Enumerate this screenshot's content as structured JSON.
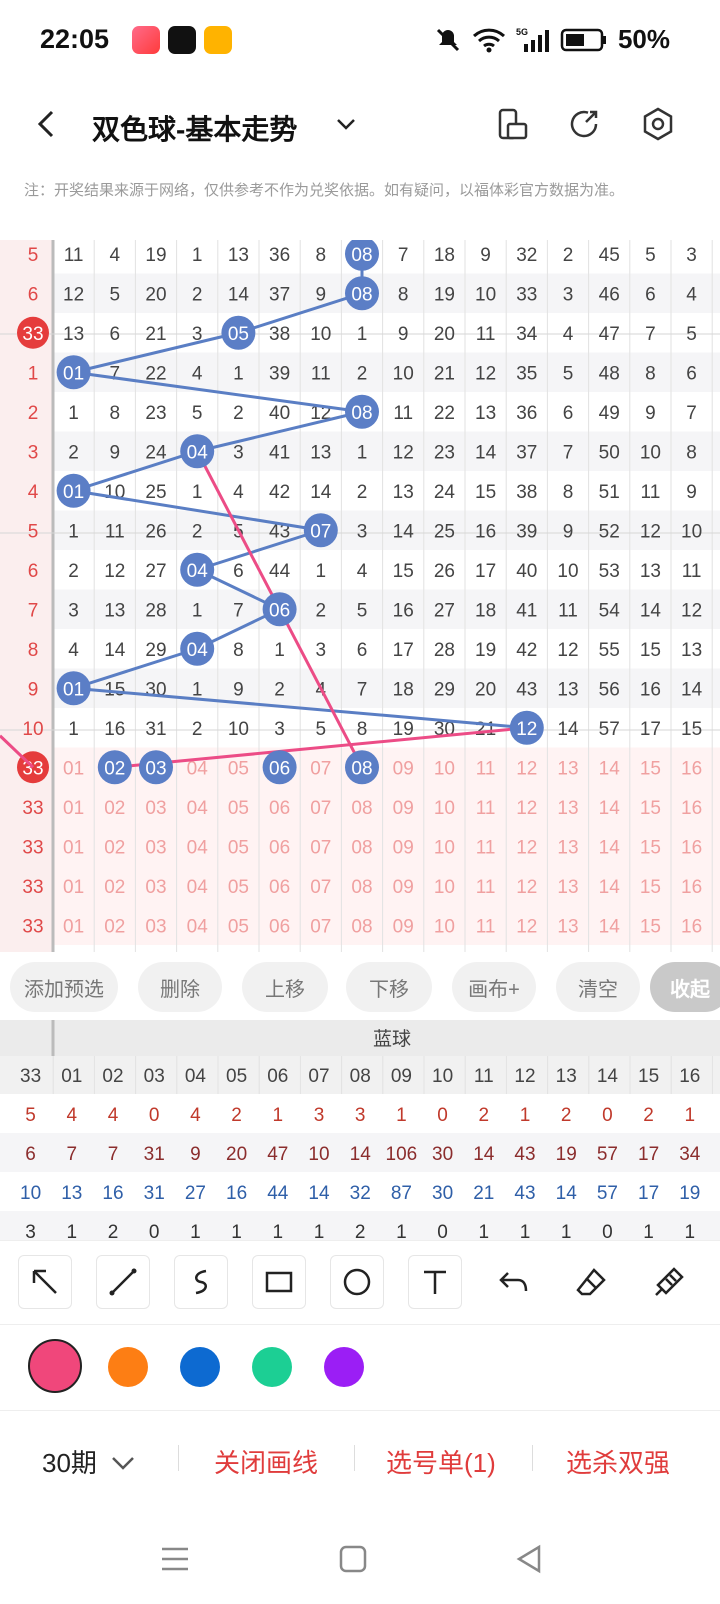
{
  "status": {
    "time": "22:05",
    "battery": "50%",
    "network": "5G"
  },
  "header": {
    "title": "双色球-基本走势"
  },
  "notice": "注：开奖结果来源于网络，仅供参考不作为兑奖依据。如有疑问，以福体彩官方数据为准。",
  "grid": {
    "left_col": [
      "5",
      "6",
      "33",
      "1",
      "2",
      "3",
      "4",
      "5",
      "6",
      "7",
      "8",
      "9",
      "10",
      "33",
      "33",
      "33",
      "33",
      "33"
    ],
    "rows": [
      [
        "11",
        "4",
        "19",
        "1",
        "13",
        "36",
        "8",
        "08",
        "7",
        "18",
        "9",
        "32",
        "2",
        "45",
        "5",
        "3"
      ],
      [
        "12",
        "5",
        "20",
        "2",
        "14",
        "37",
        "9",
        "08",
        "8",
        "19",
        "10",
        "33",
        "3",
        "46",
        "6",
        "4"
      ],
      [
        "13",
        "6",
        "21",
        "3",
        "05",
        "38",
        "10",
        "1",
        "9",
        "20",
        "11",
        "34",
        "4",
        "47",
        "7",
        "5"
      ],
      [
        "01",
        "7",
        "22",
        "4",
        "1",
        "39",
        "11",
        "2",
        "10",
        "21",
        "12",
        "35",
        "5",
        "48",
        "8",
        "6"
      ],
      [
        "1",
        "8",
        "23",
        "5",
        "2",
        "40",
        "12",
        "08",
        "11",
        "22",
        "13",
        "36",
        "6",
        "49",
        "9",
        "7"
      ],
      [
        "2",
        "9",
        "24",
        "04",
        "3",
        "41",
        "13",
        "1",
        "12",
        "23",
        "14",
        "37",
        "7",
        "50",
        "10",
        "8"
      ],
      [
        "01",
        "10",
        "25",
        "1",
        "4",
        "42",
        "14",
        "2",
        "13",
        "24",
        "15",
        "38",
        "8",
        "51",
        "11",
        "9"
      ],
      [
        "1",
        "11",
        "26",
        "2",
        "5",
        "43",
        "07",
        "3",
        "14",
        "25",
        "16",
        "39",
        "9",
        "52",
        "12",
        "10"
      ],
      [
        "2",
        "12",
        "27",
        "04",
        "6",
        "44",
        "1",
        "4",
        "15",
        "26",
        "17",
        "40",
        "10",
        "53",
        "13",
        "11"
      ],
      [
        "3",
        "13",
        "28",
        "1",
        "7",
        "06",
        "2",
        "5",
        "16",
        "27",
        "18",
        "41",
        "11",
        "54",
        "14",
        "12"
      ],
      [
        "4",
        "14",
        "29",
        "04",
        "8",
        "1",
        "3",
        "6",
        "17",
        "28",
        "19",
        "42",
        "12",
        "55",
        "15",
        "13"
      ],
      [
        "01",
        "15",
        "30",
        "1",
        "9",
        "2",
        "4",
        "7",
        "18",
        "29",
        "20",
        "43",
        "13",
        "56",
        "16",
        "14"
      ],
      [
        "1",
        "16",
        "31",
        "2",
        "10",
        "3",
        "5",
        "8",
        "19",
        "30",
        "21",
        "12",
        "14",
        "57",
        "17",
        "15"
      ],
      [
        "01",
        "02",
        "03",
        "04",
        "05",
        "06",
        "07",
        "08",
        "09",
        "10",
        "11",
        "12",
        "13",
        "14",
        "15",
        "16"
      ],
      [
        "01",
        "02",
        "03",
        "04",
        "05",
        "06",
        "07",
        "08",
        "09",
        "10",
        "11",
        "12",
        "13",
        "14",
        "15",
        "16"
      ],
      [
        "01",
        "02",
        "03",
        "04",
        "05",
        "06",
        "07",
        "08",
        "09",
        "10",
        "11",
        "12",
        "13",
        "14",
        "15",
        "16"
      ],
      [
        "01",
        "02",
        "03",
        "04",
        "05",
        "06",
        "07",
        "08",
        "09",
        "10",
        "11",
        "12",
        "13",
        "14",
        "15",
        "16"
      ],
      [
        "01",
        "02",
        "03",
        "04",
        "05",
        "06",
        "07",
        "08",
        "09",
        "10",
        "11",
        "12",
        "13",
        "14",
        "15",
        "16"
      ]
    ],
    "balls": [
      {
        "row": 0,
        "col": 7,
        "label": "08"
      },
      {
        "row": 1,
        "col": 7,
        "label": "08"
      },
      {
        "row": 2,
        "col": 4,
        "label": "05"
      },
      {
        "row": 3,
        "col": 0,
        "label": "01"
      },
      {
        "row": 4,
        "col": 7,
        "label": "08"
      },
      {
        "row": 5,
        "col": 3,
        "label": "04"
      },
      {
        "row": 6,
        "col": 0,
        "label": "01"
      },
      {
        "row": 7,
        "col": 6,
        "label": "07"
      },
      {
        "row": 8,
        "col": 3,
        "label": "04"
      },
      {
        "row": 9,
        "col": 5,
        "label": "06"
      },
      {
        "row": 10,
        "col": 3,
        "label": "04"
      },
      {
        "row": 11,
        "col": 0,
        "label": "01"
      },
      {
        "row": 12,
        "col": 11,
        "label": "12"
      },
      {
        "row": 13,
        "col": 1,
        "label": "02"
      },
      {
        "row": 13,
        "col": 2,
        "label": "03"
      },
      {
        "row": 13,
        "col": 5,
        "label": "06"
      },
      {
        "row": 13,
        "col": 7,
        "label": "08"
      }
    ],
    "red_left_balls": [
      {
        "row": 2,
        "label": "33"
      },
      {
        "row": 13,
        "label": "33"
      }
    ]
  },
  "pills": [
    "添加预选",
    "删除",
    "上移",
    "下移",
    "画布+",
    "清空",
    "收起"
  ],
  "stats": {
    "section_label": "蓝球",
    "header": [
      "33",
      "01",
      "02",
      "03",
      "04",
      "05",
      "06",
      "07",
      "08",
      "09",
      "10",
      "11",
      "12",
      "13",
      "14",
      "15",
      "16"
    ],
    "rows": [
      {
        "color": "#c0392b",
        "values": [
          "5",
          "4",
          "4",
          "0",
          "4",
          "2",
          "1",
          "3",
          "3",
          "1",
          "0",
          "2",
          "1",
          "2",
          "0",
          "2",
          "1"
        ]
      },
      {
        "color": "#8b2d2d",
        "values": [
          "6",
          "7",
          "7",
          "31",
          "9",
          "20",
          "47",
          "10",
          "14",
          "106",
          "30",
          "14",
          "43",
          "19",
          "57",
          "17",
          "34"
        ]
      },
      {
        "color": "#2f5fa8",
        "values": [
          "10",
          "13",
          "16",
          "31",
          "27",
          "16",
          "44",
          "14",
          "32",
          "87",
          "30",
          "21",
          "43",
          "14",
          "57",
          "17",
          "19"
        ]
      },
      {
        "color": "#333333",
        "values": [
          "3",
          "1",
          "2",
          "0",
          "1",
          "1",
          "1",
          "1",
          "2",
          "1",
          "0",
          "1",
          "1",
          "1",
          "0",
          "1",
          "1"
        ]
      }
    ]
  },
  "tools": [
    "arrow-tool",
    "line-tool",
    "curve-tool",
    "rectangle-tool",
    "circle-tool",
    "text-tool",
    "undo-tool",
    "eraser-tool",
    "clear-brush-tool"
  ],
  "colors": [
    "#f0477b",
    "#fd7e14",
    "#0d6ad1",
    "#1ccf94",
    "#9b1ef5"
  ],
  "bottom": {
    "periods": "30期",
    "close_draw": "关闭画线",
    "pick_list": "选号单(1)",
    "pick_kill": "选杀双强"
  }
}
